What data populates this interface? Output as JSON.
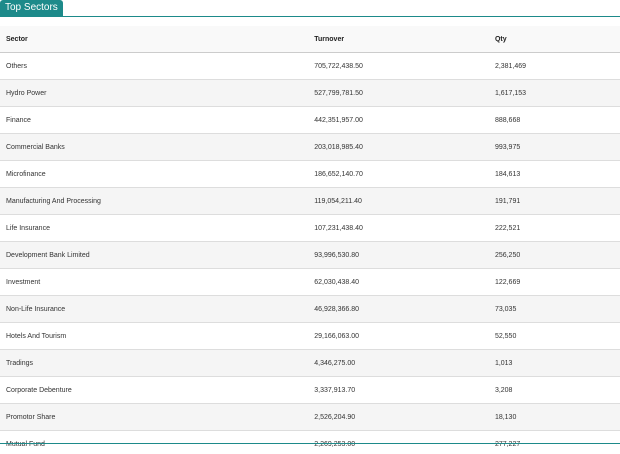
{
  "panel": {
    "tab_title": "Top Sectors"
  },
  "table": {
    "columns": {
      "sector": "Sector",
      "turnover": "Turnover",
      "qty": "Qty"
    },
    "rows": [
      {
        "sector": "Others",
        "turnover": "705,722,438.50",
        "qty": "2,381,469"
      },
      {
        "sector": "Hydro Power",
        "turnover": "527,799,781.50",
        "qty": "1,617,153"
      },
      {
        "sector": "Finance",
        "turnover": "442,351,957.00",
        "qty": "888,668"
      },
      {
        "sector": "Commercial Banks",
        "turnover": "203,018,985.40",
        "qty": "993,975"
      },
      {
        "sector": "Microfinance",
        "turnover": "186,652,140.70",
        "qty": "184,613"
      },
      {
        "sector": "Manufacturing And Processing",
        "turnover": "119,054,211.40",
        "qty": "191,791"
      },
      {
        "sector": "Life Insurance",
        "turnover": "107,231,438.40",
        "qty": "222,521"
      },
      {
        "sector": "Development Bank Limited",
        "turnover": "93,996,530.80",
        "qty": "256,250"
      },
      {
        "sector": "Investment",
        "turnover": "62,030,438.40",
        "qty": "122,669"
      },
      {
        "sector": "Non-Life Insurance",
        "turnover": "46,928,366.80",
        "qty": "73,035"
      },
      {
        "sector": "Hotels And Tourism",
        "turnover": "29,166,063.00",
        "qty": "52,550"
      },
      {
        "sector": "Tradings",
        "turnover": "4,346,275.00",
        "qty": "1,013"
      },
      {
        "sector": "Corporate Debenture",
        "turnover": "3,337,913.70",
        "qty": "3,208"
      },
      {
        "sector": "Promotor Share",
        "turnover": "2,526,204.90",
        "qty": "18,130"
      },
      {
        "sector": "Mutual Fund",
        "turnover": "2,269,253.00",
        "qty": "277,227"
      }
    ]
  },
  "colors": {
    "accent": "#1d8a8a"
  }
}
